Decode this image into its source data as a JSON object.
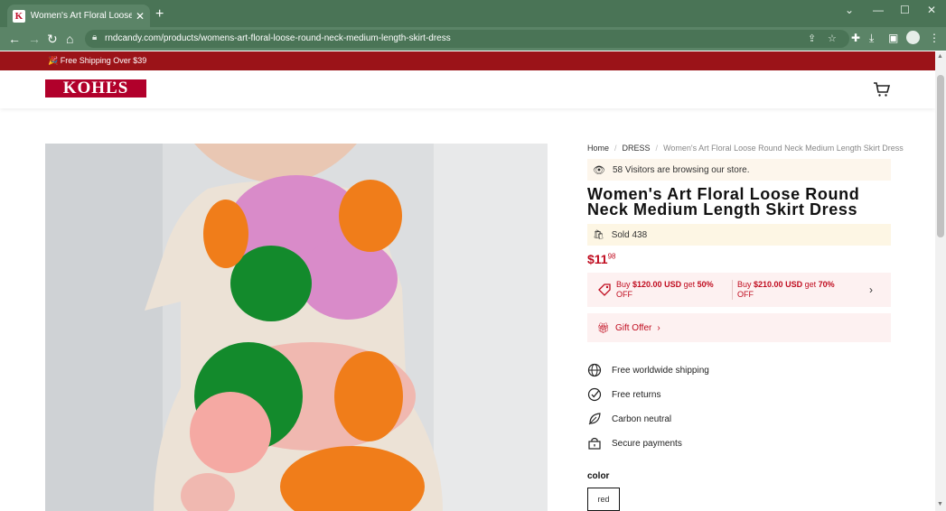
{
  "browser": {
    "tab_title": "Women's Art Floral Loose Round",
    "tab_favicon": "K",
    "url": "rndcandy.com/products/womens-art-floral-loose-round-neck-medium-length-skirt-dress"
  },
  "promo": {
    "text": "🎉 Free Shipping Over $39"
  },
  "header": {
    "logo": "KOHĽS"
  },
  "breadcrumb": {
    "home": "Home",
    "category": "DRESS",
    "current": "Women's Art Floral Loose Round Neck Medium Length Skirt Dress"
  },
  "product": {
    "visitors": "58 Visitors are browsing our store.",
    "title": "Women's Art Floral Loose Round Neck Medium Length Skirt Dress",
    "sold": "Sold 438",
    "price_main": "$11",
    "price_cents": "98",
    "offer1": {
      "pre": "Buy",
      "amount": "$120.00 USD",
      "mid": "get",
      "discount": "50%",
      "post": "OFF"
    },
    "offer2": {
      "pre": "Buy",
      "amount": "$210.00 USD",
      "mid": "get",
      "discount": "70%",
      "post": "OFF"
    },
    "gift": "Gift Offer",
    "features": [
      "Free worldwide shipping",
      "Free returns",
      "Carbon neutral",
      "Secure payments"
    ],
    "color_label": "color",
    "color_value": "red"
  },
  "colors": {
    "promo_bar": "#9b1318",
    "accent": "#c00c1f",
    "chrome": "#5b8467"
  }
}
